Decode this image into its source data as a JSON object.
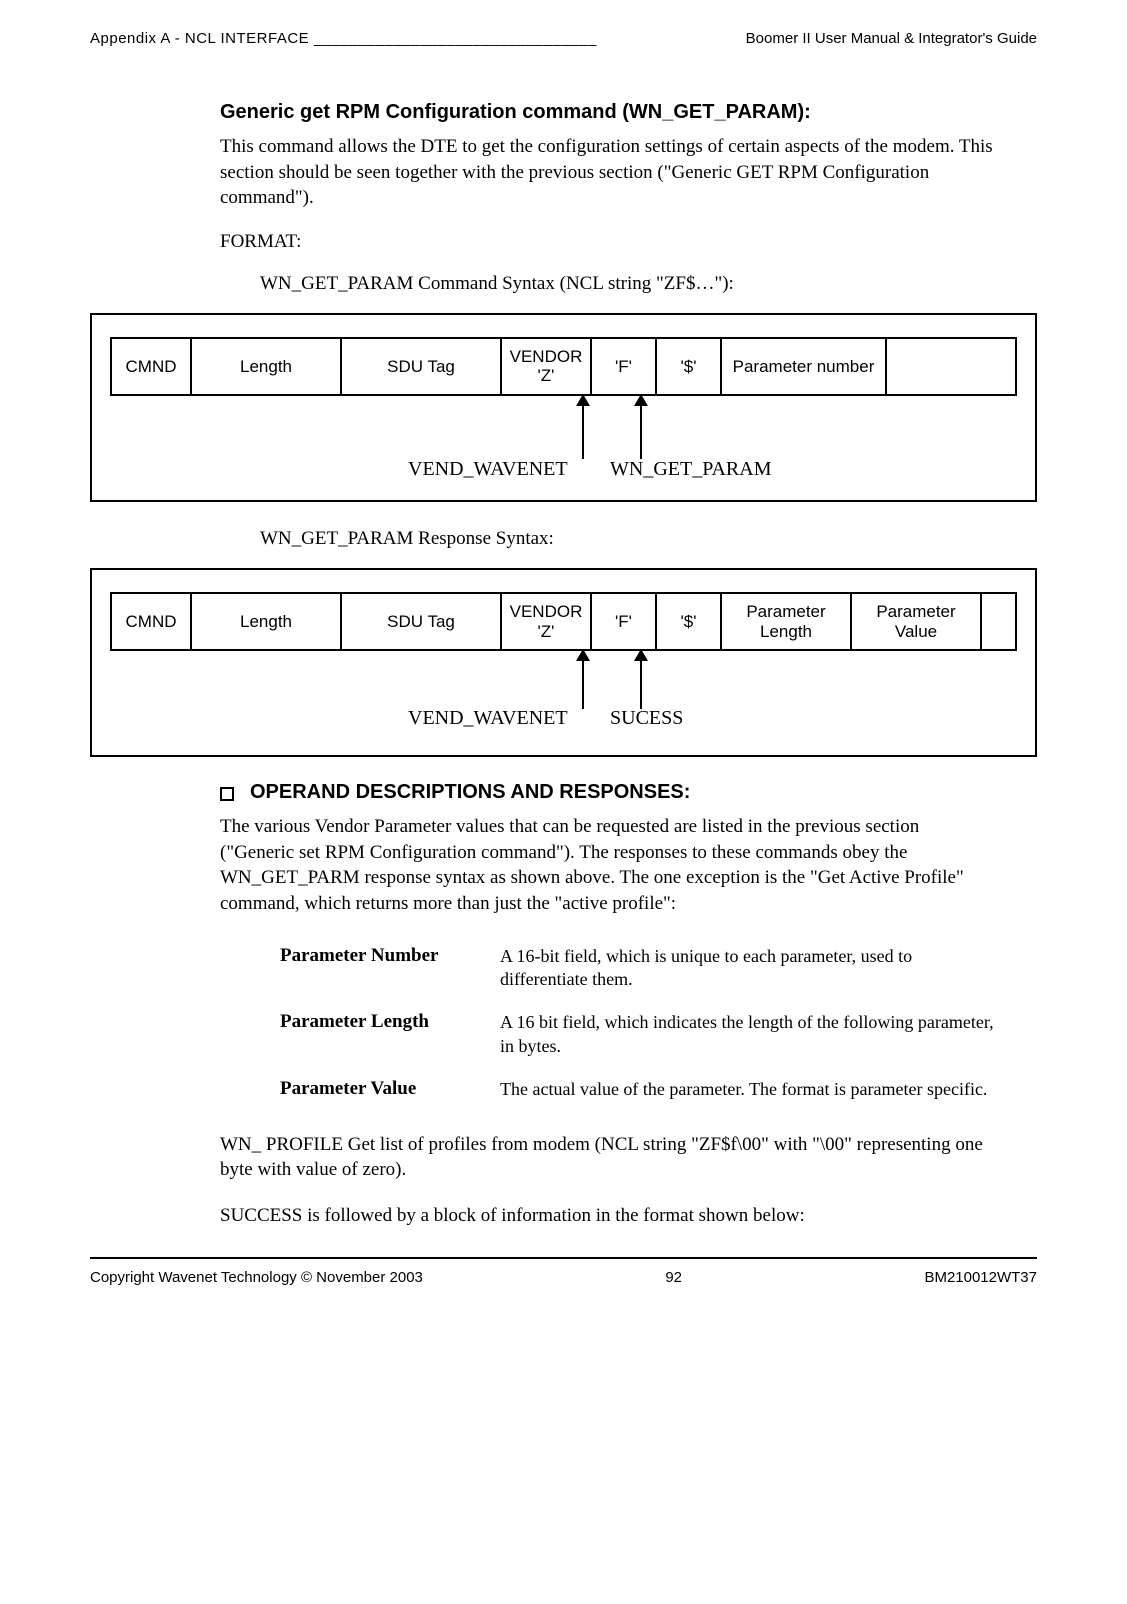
{
  "header": {
    "left": "Appendix A - NCL INTERFACE ________________________________",
    "right": "Boomer II User Manual & Integrator's Guide"
  },
  "section": {
    "title": "Generic get RPM Configuration command (WN_GET_PARAM):",
    "intro": "This command allows the DTE to get the configuration settings of certain aspects of the modem.  This section should be seen together with the previous section (\"Generic GET RPM Configuration command\").",
    "format_label": "FORMAT:",
    "cmd_caption": "WN_GET_PARAM Command Syntax (NCL string \"ZF$…\"):",
    "resp_caption": "WN_GET_PARAM Response Syntax:"
  },
  "cmd_row": {
    "c0": "CMND",
    "c1": "Length",
    "c2": "SDU Tag",
    "c3_l1": "VENDOR",
    "c3_l2": "'Z'",
    "c4": "'F'",
    "c5": "'$'",
    "c6": "Parameter number"
  },
  "cmd_labels": {
    "l1": "VEND_WAVENET",
    "l2": "WN_GET_PARAM"
  },
  "resp_row": {
    "c0": "CMND",
    "c1": "Length",
    "c2": "SDU Tag",
    "c3_l1": "VENDOR",
    "c3_l2": "'Z'",
    "c4": "'F'",
    "c5": "'$'",
    "c6_l1": "Parameter",
    "c6_l2": "Length",
    "c7_l1": "Parameter",
    "c7_l2": "Value"
  },
  "resp_labels": {
    "l1": "VEND_WAVENET",
    "l2": "SUCESS"
  },
  "operand": {
    "heading": "OPERAND DESCRIPTIONS AND RESPONSES:",
    "body": "The various Vendor Parameter values that can be requested  are listed in the previous section (\"Generic set RPM Configuration command\"). The responses to these commands obey the WN_GET_PARM response syntax as  shown above. The one exception is the \"Get Active Profile\" command, which returns more than just the \"active profile\":"
  },
  "defs": [
    {
      "term": "Parameter Number",
      "desc": "A 16-bit field, which is unique to each parameter, used to differentiate them."
    },
    {
      "term": "Parameter Length",
      "desc": "A 16 bit field, which indicates the length of the following parameter, in bytes."
    },
    {
      "term": "Parameter Value",
      "desc": "The actual value of the parameter.  The format is parameter specific."
    }
  ],
  "tail": {
    "p1": "WN_ PROFILE  Get  list of profiles from modem (NCL string \"ZF$f\\00\" with \"\\00\"  representing one byte with value of zero).",
    "p2": "SUCCESS is followed by a block of information in the format shown below:"
  },
  "footer": {
    "left": "Copyright Wavenet Technology © November 2003",
    "center": "92",
    "right": "BM210012WT37"
  }
}
